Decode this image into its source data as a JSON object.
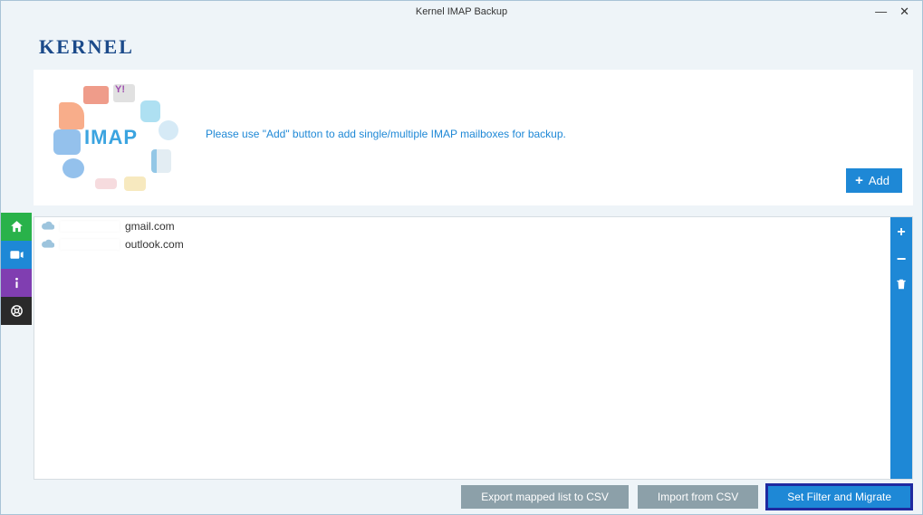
{
  "window": {
    "title": "Kernel IMAP Backup"
  },
  "brand": {
    "logo_text": "KERNEL"
  },
  "hero": {
    "imap_label": "IMAP",
    "instruction": "Please use \"Add\" button to add single/multiple IMAP mailboxes for backup.",
    "add_button": "Add"
  },
  "mailboxes": [
    {
      "domain": "gmail.com"
    },
    {
      "domain": "outlook.com"
    }
  ],
  "footer": {
    "export_label": "Export mapped list to CSV",
    "import_label": "Import from CSV",
    "migrate_label": "Set Filter and Migrate"
  },
  "illustration": {
    "yahoo_bubble": "Y!"
  }
}
